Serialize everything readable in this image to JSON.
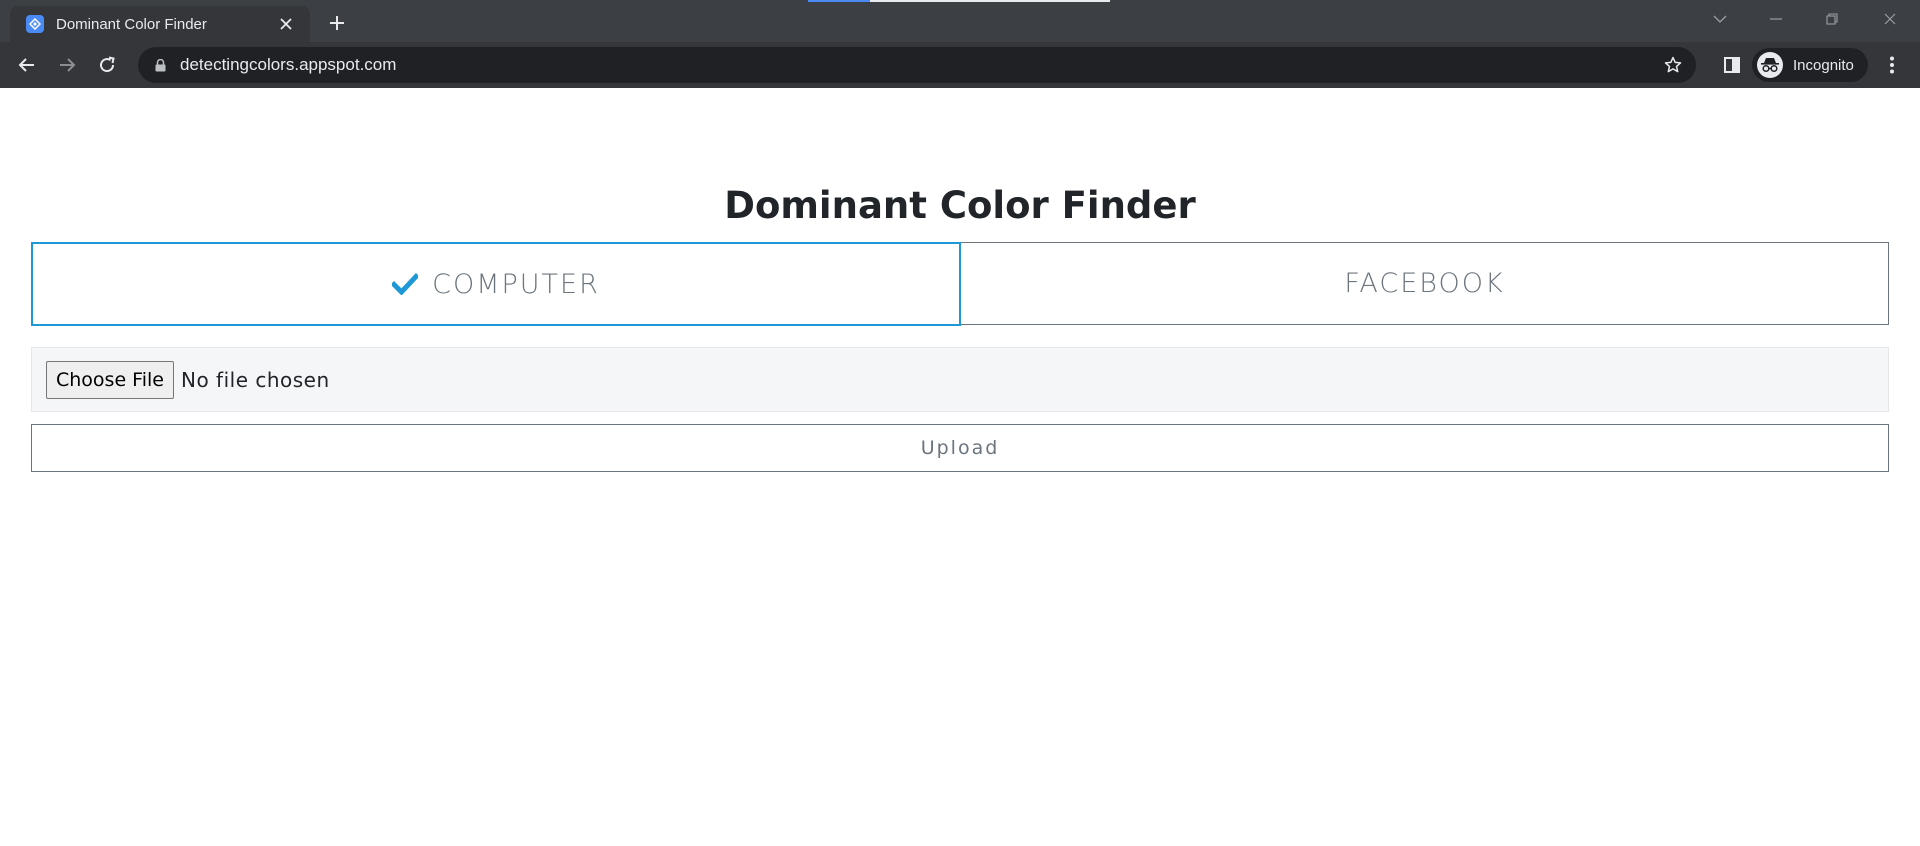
{
  "browser": {
    "tab_title": "Dominant Color Finder",
    "url": "detectingcolors.appspot.com",
    "profile_label": "Incognito",
    "accent": "#4a8af4"
  },
  "page": {
    "heading": "Dominant Color Finder",
    "source_tabs": [
      {
        "label": "COMPUTER",
        "selected": true
      },
      {
        "label": "FACEBOOK",
        "selected": false
      }
    ],
    "file_input": {
      "button_label": "Choose File",
      "status": "No file chosen"
    },
    "upload_label": "Upload",
    "colors": {
      "selected_tab_border": "#1e98d7",
      "check_icon": "#1e98d7",
      "text_muted": "#6c757d"
    }
  }
}
